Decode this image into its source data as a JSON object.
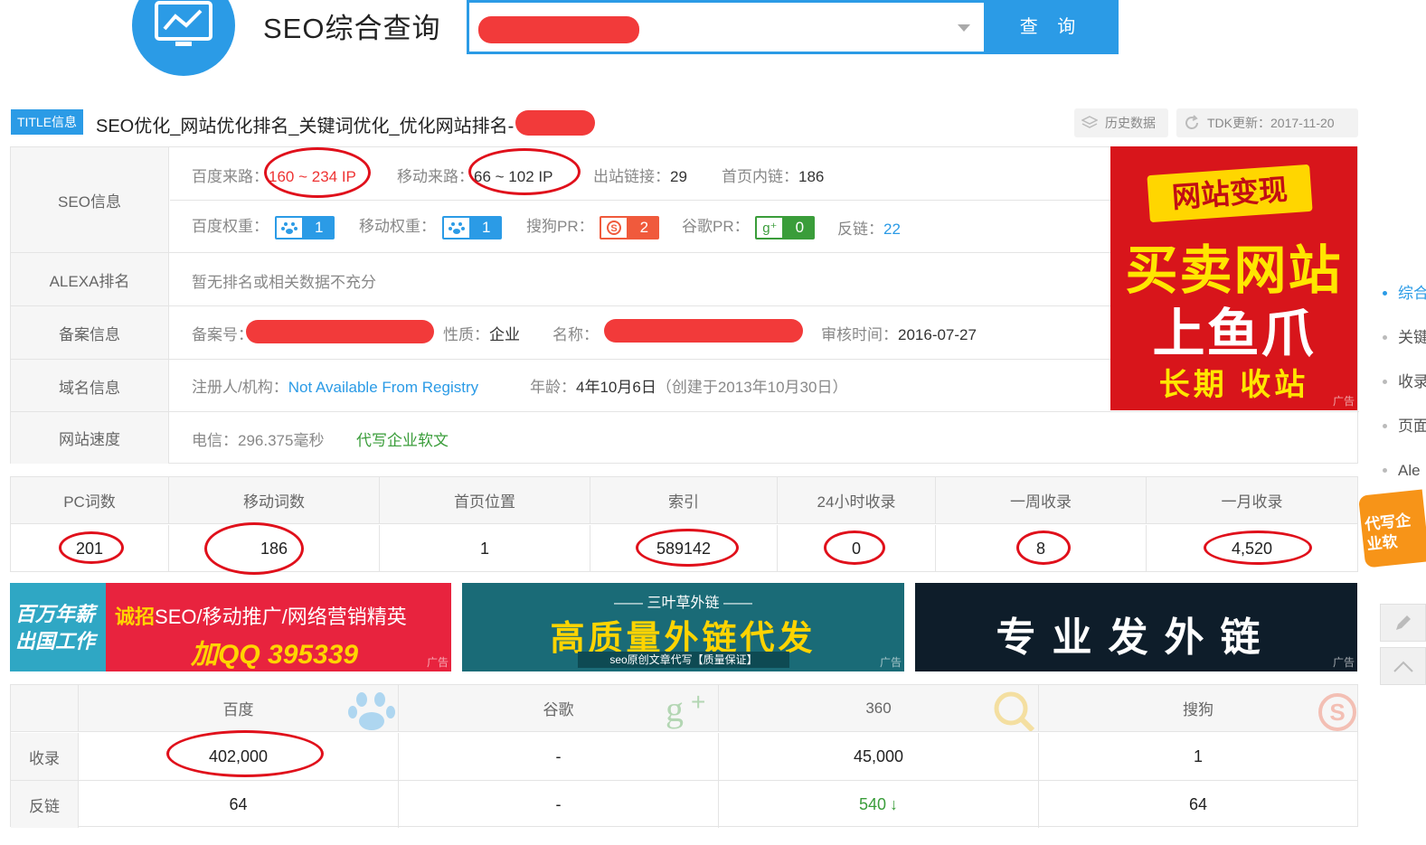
{
  "header": {
    "site_title": "SEO综合查询",
    "search_button": "查 询",
    "search_value": ""
  },
  "title_row": {
    "badge": "TITLE信息",
    "title_text": "SEO优化_网站优化排名_关键词优化_优化网站排名-",
    "history_label": "历史数据",
    "tdk_label": "TDK更新：2017-11-20"
  },
  "seo_info": {
    "label": "SEO信息",
    "baidu_traffic_label": "百度来路：",
    "baidu_traffic_value": "160 ~ 234 IP",
    "mobile_traffic_label": "移动来路：",
    "mobile_traffic_value": "66 ~ 102 IP",
    "outbound_label": "出站链接：",
    "outbound_value": "29",
    "internal_label": "首页内链：",
    "internal_value": "186",
    "baidu_weight_label": "百度权重：",
    "baidu_weight_value": "1",
    "mobile_weight_label": "移动权重：",
    "mobile_weight_value": "1",
    "sogou_pr_label": "搜狗PR：",
    "sogou_pr_value": "2",
    "google_pr_label": "谷歌PR：",
    "google_pr_value": "0",
    "backlink_label": "反链：",
    "backlink_value": "22"
  },
  "alexa": {
    "label": "ALEXA排名",
    "value": "暂无排名或相关数据不充分"
  },
  "icp": {
    "label": "备案信息",
    "number_label": "备案号：",
    "type_label": "性质：",
    "type_value": "企业",
    "name_label": "名称：",
    "audit_label": "审核时间：",
    "audit_value": "2016-07-27"
  },
  "domain": {
    "label": "域名信息",
    "registrant_label": "注册人/机构：",
    "registrant_value": "Not Available From Registry",
    "age_label": "年龄：",
    "age_value": "4年10月6日",
    "created_value": "（创建于2013年10月30日）"
  },
  "speed": {
    "label": "网站速度",
    "telecom_value": "电信：296.375毫秒",
    "link_text": "代写企业软文"
  },
  "ad_right": {
    "line1": "网站变现",
    "line2": "买卖网站",
    "line3": "上鱼爪",
    "line4": "长期 收站",
    "tag": "广告"
  },
  "stats": {
    "headers": [
      "PC词数",
      "移动词数",
      "首页位置",
      "索引",
      "24小时收录",
      "一周收录",
      "一月收录"
    ],
    "values": [
      "201",
      "186",
      "1",
      "589142",
      "0",
      "8",
      "4,520"
    ]
  },
  "banners": {
    "b1_left": "百万年薪出国工作",
    "b1_line1_a": "诚招",
    "b1_line1_b": "SEO/移动推广/网络营销精英",
    "b1_line2": "加QQ 395339",
    "b2_top": "—— 三叶草外链 ——",
    "b2_main": "高质量外链代发",
    "b2_sub": "seo原创文章代写【质量保证】",
    "b3_main": "专业发外链",
    "tag": "广告"
  },
  "engines": {
    "headers": [
      "百度",
      "谷歌",
      "360",
      "搜狗"
    ],
    "row_labels": [
      "收录",
      "反链"
    ],
    "index_values": [
      "402,000",
      "-",
      "45,000",
      "1"
    ],
    "backlink_values": [
      "64",
      "-",
      "540",
      "64"
    ],
    "trend_symbol": "↓"
  },
  "side_nav": {
    "items": [
      "综合",
      "关键",
      "收录",
      "页面",
      "Ale"
    ],
    "float_ad": "代写企业软"
  },
  "colors": {
    "accent": "#2b9be6",
    "highlight_red": "#e33333",
    "green": "#3a9d3a"
  }
}
